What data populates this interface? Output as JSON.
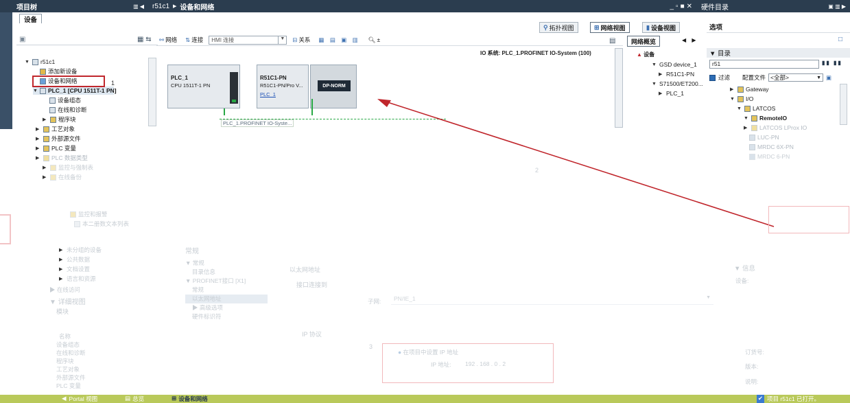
{
  "left_panel": {
    "title": "项目树",
    "devices_tab": "设备",
    "tree": [
      {
        "label": "r51c1"
      },
      {
        "label": "添加新设备"
      },
      {
        "label": "设备和网络"
      },
      {
        "label": "PLC_1 [CPU 1511T-1 PN]"
      },
      {
        "label": "设备组态"
      },
      {
        "label": "在线和诊断"
      },
      {
        "label": "程序块"
      },
      {
        "label": "工艺对象"
      },
      {
        "label": "外部源文件"
      },
      {
        "label": "PLC 变量"
      },
      {
        "label": "PLC 数据类型"
      },
      {
        "label": "监控与强制表"
      },
      {
        "label": "在线备份"
      },
      {
        "label": "监控和报警"
      },
      {
        "label": "本二册数文本列表"
      },
      {
        "label": "未分组的设备"
      },
      {
        "label": "公共数据"
      },
      {
        "label": "文档设置"
      },
      {
        "label": "语言和资源"
      },
      {
        "label": "在线访问"
      }
    ],
    "detail_view": "详细视图",
    "module_label": "模块",
    "name_label": "名称",
    "detail_items": [
      "设备组态",
      "在线和诊断",
      "程序块",
      "工艺对象",
      "外部源文件",
      "PLC 变量"
    ],
    "annotation_1": "1"
  },
  "center": {
    "breadcrumb": [
      "r51c1",
      "设备和网络"
    ],
    "view_tabs": [
      "拓扑视图",
      "网络视图",
      "设备视图"
    ],
    "toolbar": {
      "network": "网络",
      "connection": "连接",
      "connection_select": "HMI 连接",
      "relations": "关系",
      "zoom": "±"
    },
    "io_system_label": "IO 系统: PLC_1.PROFINET IO-System (100)",
    "plc_name": "PLC_1",
    "plc_type": "CPU 1511T-1 PN",
    "device2_name": "R51C1-PN",
    "device2_type": "R51C1-PN/Pro V...",
    "device2_link": "PLC_1",
    "dp_norm": "DP-NORM",
    "network_line_label": "PLC_1.PROFINET IO-Syste...",
    "annotation_2": "2",
    "annotation_3": "3",
    "properties": {
      "general": "常规",
      "general_sub": "常规",
      "catalog_info": "目录信息",
      "interface": "PROFINET接口 [X1]",
      "general2": "常规",
      "ethernet": "以太网地址",
      "advanced": "高级选项",
      "hw_id": "硬件标识符",
      "section_ethernet": "以太网地址",
      "interface_connected": "接口连接到",
      "subnet_label": "子网:",
      "subnet_value": "PN/IE_1",
      "ip_protocol": "IP 协议",
      "set_in_project": "在项目中设置 IP 地址",
      "ip_label": "IP 地址:",
      "ip_value": "192 . 168 . 0 . 2"
    },
    "network_overview_tab": "网络概览",
    "overview": {
      "header": "设备",
      "rows": [
        "GSD device_1",
        "R51C1-PN",
        "S71500/ET200...",
        "PLC_1"
      ]
    }
  },
  "right_panel": {
    "title": "硬件目录",
    "options": "选项",
    "catalog": "目录",
    "search_value": "r51",
    "filter_label": "过滤",
    "profile_label": "配置文件",
    "profile_value": "<全部>",
    "catalog_items": [
      "Gateway",
      "I/O",
      "LATCOS",
      "RemoteIO",
      "LATCOS LProx IO",
      "LUC-PN",
      "MRDC 6X-PN",
      "MRDC 6-PN"
    ],
    "info_header": "信息",
    "device_label": "设备:",
    "order_no": "订货号:",
    "version": "版本:",
    "description": "说明:"
  },
  "statusbar": {
    "portal_view": "Portal 视图",
    "overview": "总览",
    "devices_networks": "设备和网络",
    "status_text": "项目 r51c1 已打开。"
  },
  "window_controls": [
    "_",
    "▫",
    "■",
    "✕"
  ],
  "colors": {
    "title_bar": "#2b3d4f",
    "status_bar": "#b9c95a",
    "highlight_red": "#c0262c",
    "plc_green": "#27a844"
  }
}
